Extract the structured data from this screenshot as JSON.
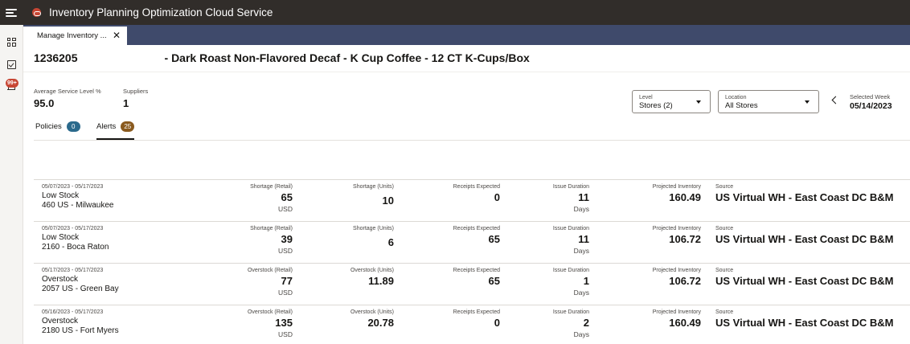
{
  "app": {
    "title": "Inventory Planning Optimization Cloud Service"
  },
  "tabs": [
    {
      "label": "Manage Inventory ..."
    }
  ],
  "left_rail": {
    "notification_badge": "99+"
  },
  "product": {
    "id": "1236205",
    "name": "- Dark Roast Non-Flavored Decaf - K Cup Coffee - 12 CT K-Cups/Box"
  },
  "metrics": {
    "service_level": {
      "label": "Average Service Level %",
      "value": "95.0"
    },
    "suppliers": {
      "label": "Suppliers",
      "value": "1"
    }
  },
  "filters": {
    "level": {
      "label": "Level",
      "value": "Stores (2)"
    },
    "location": {
      "label": "Location",
      "value": "All Stores"
    },
    "week": {
      "label": "Selected Week",
      "value": "05/14/2023"
    }
  },
  "subtabs": [
    {
      "label": "Policies",
      "count": "0",
      "color": "#2b6a8c"
    },
    {
      "label": "Alerts",
      "count": "25",
      "color": "#8a5a1e"
    }
  ],
  "alerts": [
    {
      "dates": "05/07/2023 - 05/17/2023",
      "type": "Low Stock",
      "location": "460 US - Milwaukee",
      "col1_label": "Shortage (Retail)",
      "col1_value": "65",
      "col1_unit": "USD",
      "col2_label": "Shortage (Units)",
      "col2_value": "10",
      "receipts_label": "Receipts Expected",
      "receipts_value": "0",
      "duration_label": "Issue Duration",
      "duration_value": "11",
      "duration_unit": "Days",
      "projected_label": "Projected Inventory",
      "projected_value": "160.49",
      "source_label": "Source",
      "source_value": "US Virtual WH - East Coast DC B&M"
    },
    {
      "dates": "05/07/2023 - 05/17/2023",
      "type": "Low Stock",
      "location": "2160 - Boca Raton",
      "col1_label": "Shortage (Retail)",
      "col1_value": "39",
      "col1_unit": "USD",
      "col2_label": "Shortage (Units)",
      "col2_value": "6",
      "receipts_label": "Receipts Expected",
      "receipts_value": "65",
      "duration_label": "Issue Duration",
      "duration_value": "11",
      "duration_unit": "Days",
      "projected_label": "Projected Inventory",
      "projected_value": "106.72",
      "source_label": "Source",
      "source_value": "US Virtual WH - East Coast DC B&M"
    },
    {
      "dates": "05/17/2023 - 05/17/2023",
      "type": "Overstock",
      "location": "2057 US - Green Bay",
      "col1_label": "Overstock (Retail)",
      "col1_value": "77",
      "col1_unit": "USD",
      "col2_label": "Overstock (Units)",
      "col2_value": "11.89",
      "receipts_label": "Receipts Expected",
      "receipts_value": "65",
      "duration_label": "Issue Duration",
      "duration_value": "1",
      "duration_unit": "Days",
      "projected_label": "Projected Inventory",
      "projected_value": "106.72",
      "source_label": "Source",
      "source_value": "US Virtual WH - East Coast DC B&M"
    },
    {
      "dates": "05/16/2023 - 05/17/2023",
      "type": "Overstock",
      "location": "2180 US - Fort Myers",
      "col1_label": "Overstock (Retail)",
      "col1_value": "135",
      "col1_unit": "USD",
      "col2_label": "Overstock (Units)",
      "col2_value": "20.78",
      "receipts_label": "Receipts Expected",
      "receipts_value": "0",
      "duration_label": "Issue Duration",
      "duration_value": "2",
      "duration_unit": "Days",
      "projected_label": "Projected Inventory",
      "projected_value": "160.49",
      "source_label": "Source",
      "source_value": "US Virtual WH - East Coast DC B&M"
    }
  ]
}
